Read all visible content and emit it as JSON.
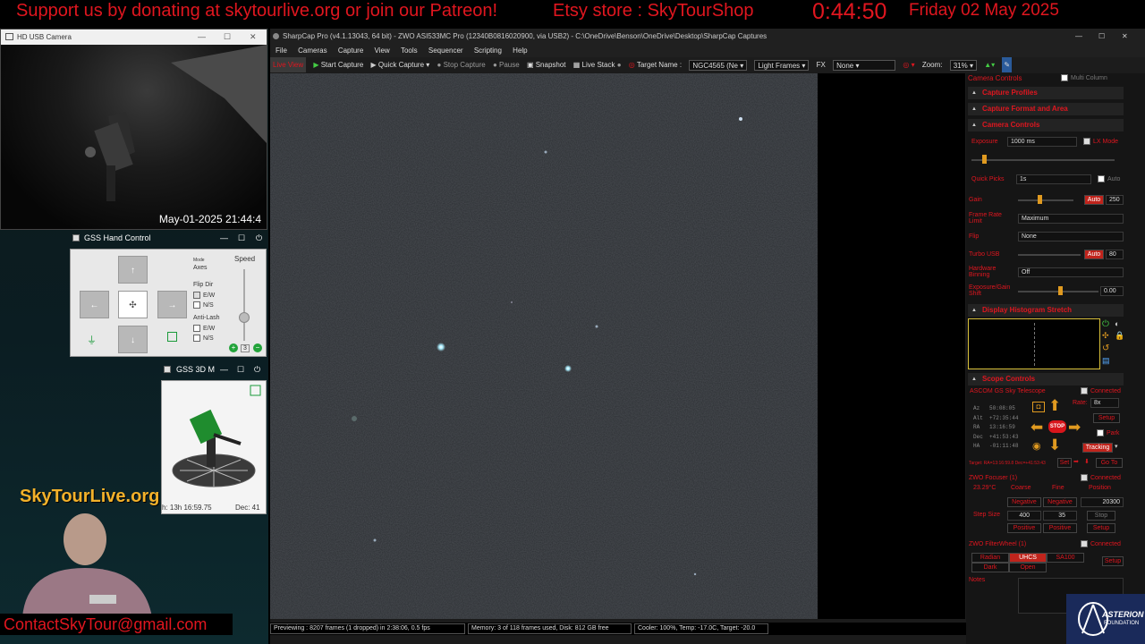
{
  "banner": {
    "donate": "Support us by donating at skytourlive.org or join our Patreon!",
    "etsy": "Etsy store : SkyTourShop",
    "timer": "0:44:50",
    "date": "Friday 02 May 2025"
  },
  "hd_camera": {
    "title": "HD USB Camera",
    "timestamp": "May-01-2025 21:44:4"
  },
  "gss_hand": {
    "title": "GSS Hand Control",
    "speed_label": "Speed",
    "mode_label": "Mode",
    "mode_value": "Axes",
    "flip_label": "Flip Dir",
    "flip_ew": "E/W",
    "flip_ns": "N/S",
    "antilash_label": "Anti-Lash",
    "antilash_ew": "E/W",
    "antilash_ns": "N/S",
    "speed_value": "3",
    "arrow_up": "↑",
    "arrow_down": "↓",
    "arrow_left": "←",
    "arrow_right": "→",
    "center": "✣"
  },
  "gss_3d": {
    "title": "GSS 3D M",
    "ra": "h: 13h 16:59.75",
    "dec": "Dec: 41"
  },
  "overlay": {
    "logo": "SkyTourLive.org",
    "contact": "ContactSkyTour@gmail.com"
  },
  "sharpcap": {
    "title": "SharpCap Pro (v4.1.13043, 64 bit) - ZWO ASI533MC Pro (12340B0816020900, via USB2) - C:\\OneDrive\\Benson\\OneDrive\\Desktop\\SharpCap Captures",
    "menu": [
      "File",
      "Cameras",
      "Capture",
      "View",
      "Tools",
      "Sequencer",
      "Scripting",
      "Help"
    ],
    "toolbar": {
      "live_view": "Live View",
      "start_capture": "Start Capture",
      "quick_capture": "Quick Capture",
      "stop_capture": "Stop Capture",
      "pause": "Pause",
      "snapshot": "Snapshot",
      "live_stack": "Live Stack",
      "target_name_label": "Target Name :",
      "target_name_value": "NGC4565 (Ne",
      "frame_type": "Light Frames",
      "fx_label": "FX",
      "fx_value": "None",
      "zoom_label": "Zoom:",
      "zoom_value": "31%"
    },
    "status": {
      "previewing": "Previewing : 8207 frames (1 dropped) in 2:38:06, 0.5 fps",
      "memory": "Memory: 3 of 118 frames used, Disk: 812 GB free",
      "cooler": "Cooler: 100%, Temp: -17.0C, Target: -20.0"
    }
  },
  "panel": {
    "header": "Camera Controls",
    "multi_column": "Multi Column",
    "sections": {
      "capture_profiles": "Capture Profiles",
      "capture_format": "Capture Format and Area",
      "camera_controls": "Camera Controls",
      "histogram": "Display Histogram Stretch",
      "scope": "Scope Controls"
    },
    "exposure_label": "Exposure",
    "exposure_value": "1000 ms",
    "lx_mode": "LX Mode",
    "quick_picks_label": "Quick Picks",
    "quick_picks_value": "1s",
    "auto": "Auto",
    "gain_label": "Gain",
    "gain_auto": "Auto",
    "gain_value": "250",
    "frame_rate_label": "Frame Rate Limit",
    "frame_rate_value": "Maximum",
    "flip_label": "Flip",
    "flip_value": "None",
    "turbo_label": "Turbo USB",
    "turbo_auto": "Auto",
    "turbo_value": "80",
    "hw_binning_label": "Hardware Binning",
    "hw_binning_value": "Off",
    "exp_gain_label": "Exposure/Gain Shift",
    "exp_gain_value": "0.00",
    "scope": {
      "name": "ASCOM GS Sky Telescope",
      "connected": "Connected",
      "az": "Az",
      "az_val": "50:08:05",
      "alt": "Alt",
      "alt_val": "+72:35:44",
      "ra": "RA",
      "ra_val": "13:16:59",
      "dec": "Dec",
      "dec_val": "+41:53:43",
      "ha": "HA",
      "ha_val": "-01:11:48",
      "rate_label": "Rate:",
      "rate_value": "8x",
      "setup": "Setup",
      "park": "Park",
      "tracking": "Tracking",
      "stop": "STOP",
      "target": "Target: RA=13:16:59.8 Dec=+41:53:43",
      "set": "Set",
      "goto": "Go To"
    },
    "focuser": {
      "name": "ZWO Focuser (1)",
      "connected": "Connected",
      "temp": "23.29°C",
      "coarse": "Coarse",
      "fine": "Fine",
      "position_label": "Position",
      "neg1": "Negative",
      "neg2": "Negative",
      "position_value": "20300",
      "step_label": "Step Size",
      "step_coarse": "400",
      "step_fine": "35",
      "stop": "Stop",
      "pos1": "Positive",
      "pos2": "Positive",
      "setup": "Setup"
    },
    "filterwheel": {
      "name": "ZWO FilterWheel (1)",
      "connected": "Connected",
      "filters": [
        "Radian",
        "UHCS",
        "SA100",
        "Dark",
        "Open"
      ],
      "setup": "Setup"
    },
    "notes_label": "Notes"
  },
  "asterion": {
    "name": "ASTERION",
    "sub": "FOUNDATION"
  }
}
